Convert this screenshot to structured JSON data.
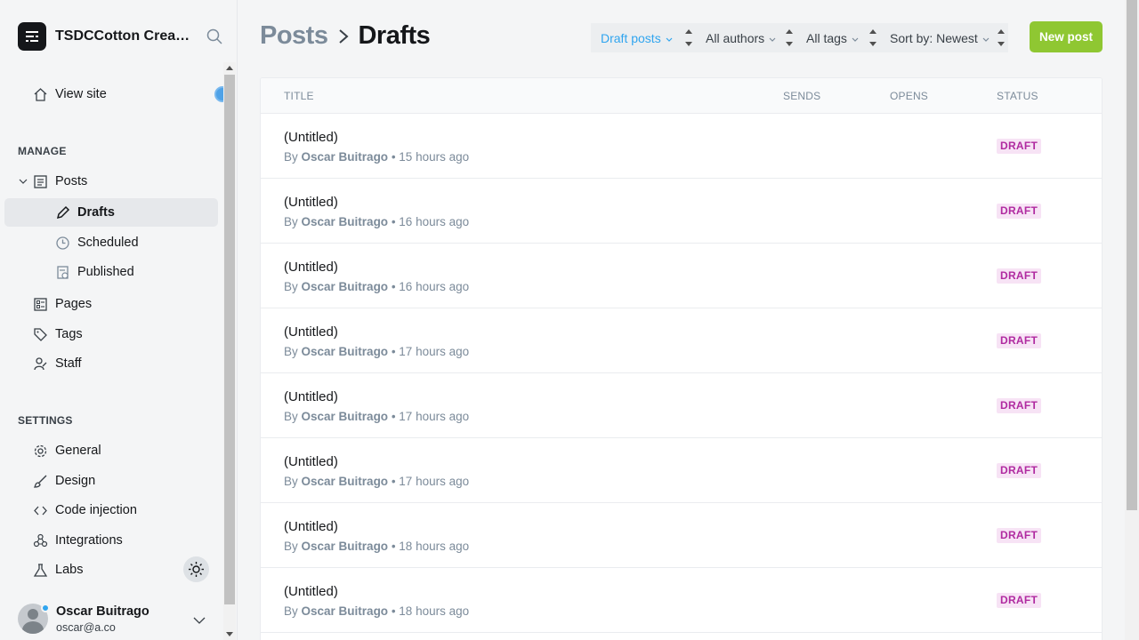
{
  "app": {
    "site_title": "TSDCCotton Creati..."
  },
  "sidebar": {
    "view_site": "View site",
    "manage_label": "MANAGE",
    "manage_items": [
      {
        "label": "Posts"
      },
      {
        "label": "Drafts"
      },
      {
        "label": "Scheduled"
      },
      {
        "label": "Published"
      },
      {
        "label": "Pages"
      },
      {
        "label": "Tags"
      },
      {
        "label": "Staff"
      }
    ],
    "settings_label": "SETTINGS",
    "settings_items": [
      {
        "label": "General"
      },
      {
        "label": "Design"
      },
      {
        "label": "Code injection"
      },
      {
        "label": "Integrations"
      },
      {
        "label": "Labs"
      }
    ],
    "user": {
      "name": "Oscar Buitrago",
      "email": "oscar@a.co"
    }
  },
  "header": {
    "breadcrumb_parent": "Posts",
    "breadcrumb_current": "Drafts",
    "filters": [
      {
        "label": "Draft posts"
      },
      {
        "label": "All authors"
      },
      {
        "label": "All tags"
      },
      {
        "label": "Sort by: Newest"
      }
    ],
    "new_post_label": "New post"
  },
  "table": {
    "columns": [
      "TITLE",
      "SENDS",
      "OPENS",
      "STATUS"
    ],
    "rows": [
      {
        "title": "(Untitled)",
        "by": "By",
        "author": "Oscar Buitrago",
        "time": "15 hours ago",
        "status": "DRAFT"
      },
      {
        "title": "(Untitled)",
        "by": "By",
        "author": "Oscar Buitrago",
        "time": "16 hours ago",
        "status": "DRAFT"
      },
      {
        "title": "(Untitled)",
        "by": "By",
        "author": "Oscar Buitrago",
        "time": "16 hours ago",
        "status": "DRAFT"
      },
      {
        "title": "(Untitled)",
        "by": "By",
        "author": "Oscar Buitrago",
        "time": "17 hours ago",
        "status": "DRAFT"
      },
      {
        "title": "(Untitled)",
        "by": "By",
        "author": "Oscar Buitrago",
        "time": "17 hours ago",
        "status": "DRAFT"
      },
      {
        "title": "(Untitled)",
        "by": "By",
        "author": "Oscar Buitrago",
        "time": "17 hours ago",
        "status": "DRAFT"
      },
      {
        "title": "(Untitled)",
        "by": "By",
        "author": "Oscar Buitrago",
        "time": "18 hours ago",
        "status": "DRAFT"
      },
      {
        "title": "(Untitled)",
        "by": "By",
        "author": "Oscar Buitrago",
        "time": "18 hours ago",
        "status": "DRAFT"
      }
    ]
  },
  "colors": {
    "accent": "#30a5ef",
    "new_post_button": "#8fc732",
    "draft_badge_bg": "#f7e3f5",
    "draft_badge_text": "#b02aa0"
  },
  "icons": {
    "logo": "ghost-logo-icon",
    "search": "search-icon",
    "view_site": "home-icon",
    "posts": "posts-icon",
    "drafts": "pencil-icon",
    "scheduled": "clock-icon",
    "published": "published-icon",
    "pages": "pages-icon",
    "tags": "tag-icon",
    "staff": "staff-icon",
    "general": "gear-icon",
    "design": "brush-icon",
    "code_injection": "code-icon",
    "integrations": "integrations-icon",
    "labs": "flask-icon",
    "theme": "sun-icon"
  }
}
